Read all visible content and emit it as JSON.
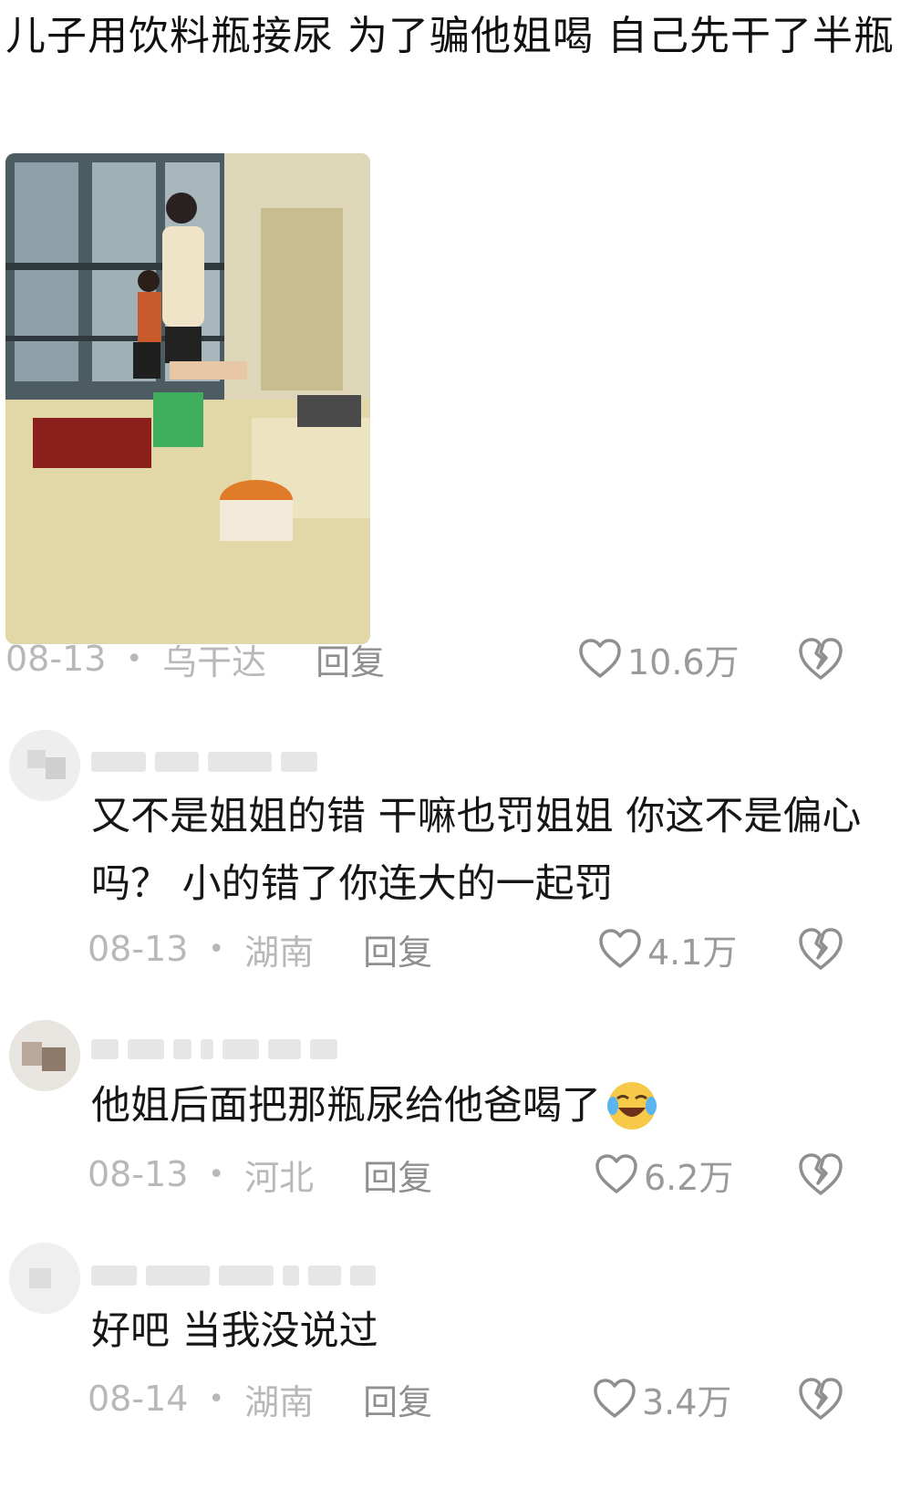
{
  "post": {
    "text": "儿子用饮料瓶接尿  为了骗他姐喝  自己先干了半瓶",
    "date": "08-13",
    "location": "乌干达",
    "reply_label": "回复",
    "likes": "10.6万"
  },
  "comments": [
    {
      "text": "又不是姐姐的错 干嘛也罚姐姐 你这不是偏心吗？ 小的错了你连大的一起罚",
      "date": "08-13",
      "location": "湖南",
      "reply_label": "回复",
      "likes": "4.1万"
    },
    {
      "text": "他姐后面把那瓶尿给他爸喝了",
      "emoji": "laughing-crying-emoji",
      "date": "08-13",
      "location": "河北",
      "reply_label": "回复",
      "likes": "6.2万"
    },
    {
      "text": "好吧 当我没说过",
      "date": "08-14",
      "location": "湖南",
      "reply_label": "回复",
      "likes": "3.4万"
    }
  ],
  "icons": {
    "like": "heart-outline-icon",
    "dislike": "broken-heart-icon"
  },
  "colors": {
    "meta_text": "#b8b8b8",
    "body_text": "#161616"
  }
}
